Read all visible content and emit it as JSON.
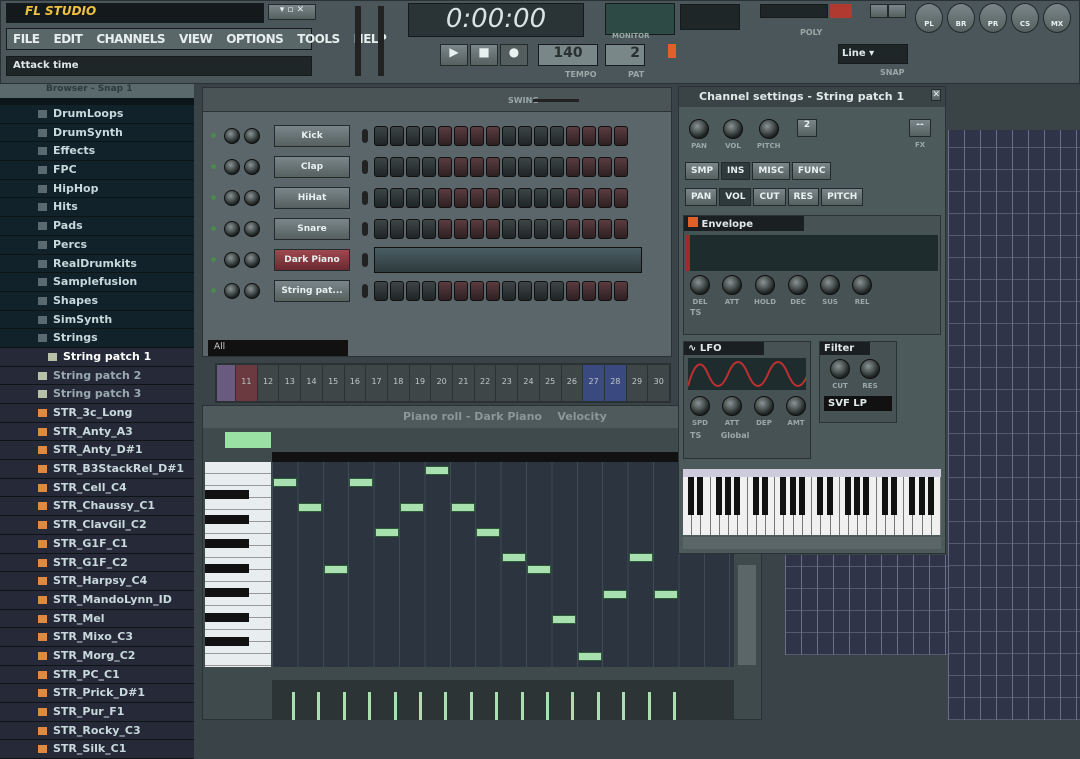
{
  "app": {
    "title": "FL STUDIO",
    "hint": "Attack time"
  },
  "menu": [
    "FILE",
    "EDIT",
    "CHANNELS",
    "VIEW",
    "OPTIONS",
    "TOOLS",
    "HELP"
  ],
  "transport": {
    "time": "0:00:00",
    "tempo_label": "TEMPO",
    "tempo": "140",
    "pat_label": "PAT",
    "pat": "2",
    "poly_label": "POLY",
    "snap_label": "SNAP",
    "snap": "Line",
    "monitor_label": "MONITOR"
  },
  "toolbar_windows": [
    "PL",
    "BR",
    "PR",
    "CS",
    "MX"
  ],
  "browser": {
    "title": "Browser - Snap 1",
    "folders": [
      "DrumLoops",
      "DrumSynth",
      "Effects",
      "FPC",
      "HipHop",
      "Hits",
      "Pads",
      "Percs",
      "RealDrumkits",
      "Samplefusion",
      "Shapes",
      "SimSynth",
      "Strings"
    ],
    "presets": [
      "String patch 1",
      "String patch 2",
      "String patch 3"
    ],
    "samples": [
      "STR_3c_Long",
      "STR_Anty_A3",
      "STR_Anty_D#1",
      "STR_B3StackRel_D#1",
      "STR_Cell_C4",
      "STR_Chaussy_C1",
      "STR_ClavGil_C2",
      "STR_G1F_C1",
      "STR_G1F_C2",
      "STR_Harpsy_C4",
      "STR_MandoLynn_ID",
      "STR_Mel",
      "STR_Mixo_C3",
      "STR_Morg_C2",
      "STR_PC_C1",
      "STR_Prick_D#1",
      "STR_Pur_F1",
      "STR_Rocky_C3",
      "STR_Silk_C1"
    ]
  },
  "step_seq": {
    "swing_label": "SWING",
    "all_label": "All",
    "steps": 16,
    "channels": [
      {
        "name": "Kick"
      },
      {
        "name": "Clap"
      },
      {
        "name": "HiHat"
      },
      {
        "name": "Snare"
      },
      {
        "name": "Dark Piano",
        "piano": true
      },
      {
        "name": "String pat..."
      }
    ]
  },
  "patterns": [
    "11",
    "12",
    "13",
    "14",
    "15",
    "16",
    "17",
    "18",
    "19",
    "20",
    "21",
    "22",
    "23",
    "24",
    "25",
    "26",
    "27",
    "28",
    "29",
    "30"
  ],
  "piano_roll": {
    "title": "Piano roll - Dark Piano",
    "mode": "Velocity",
    "notes": [
      {
        "step": 0,
        "pitch": 83
      },
      {
        "step": 1,
        "pitch": 81
      },
      {
        "step": 2,
        "pitch": 76
      },
      {
        "step": 3,
        "pitch": 83
      },
      {
        "step": 4,
        "pitch": 79
      },
      {
        "step": 5,
        "pitch": 81
      },
      {
        "step": 6,
        "pitch": 84
      },
      {
        "step": 7,
        "pitch": 81
      },
      {
        "step": 8,
        "pitch": 79
      },
      {
        "step": 9,
        "pitch": 77
      },
      {
        "step": 10,
        "pitch": 76
      },
      {
        "step": 11,
        "pitch": 72
      },
      {
        "step": 12,
        "pitch": 69
      },
      {
        "step": 13,
        "pitch": 74
      },
      {
        "step": 14,
        "pitch": 77
      },
      {
        "step": 15,
        "pitch": 74
      }
    ]
  },
  "channel_settings": {
    "title": "Channel settings - String patch 1",
    "top_knobs": [
      "PAN",
      "VOL",
      "PITCH"
    ],
    "fx_label": "FX",
    "tabs1": [
      "SMP",
      "INS",
      "MISC",
      "FUNC"
    ],
    "tabs2": [
      "PAN",
      "VOL",
      "CUT",
      "RES",
      "PITCH"
    ],
    "envelope_label": "Envelope",
    "env_knobs": [
      "DEL",
      "ATT",
      "HOLD",
      "DEC",
      "SUS",
      "REL"
    ],
    "ts_label": "TS",
    "lfo_label": "LFO",
    "lfo_knobs": [
      "SPD",
      "ATT",
      "DEP",
      "AMT"
    ],
    "global_label": "Global",
    "filter_label": "Filter",
    "filter_knobs": [
      "CUT",
      "RES"
    ],
    "filter_type": "SVF LP"
  },
  "colors": {
    "note": "#a8e0b0",
    "accent": "#e0602a"
  }
}
